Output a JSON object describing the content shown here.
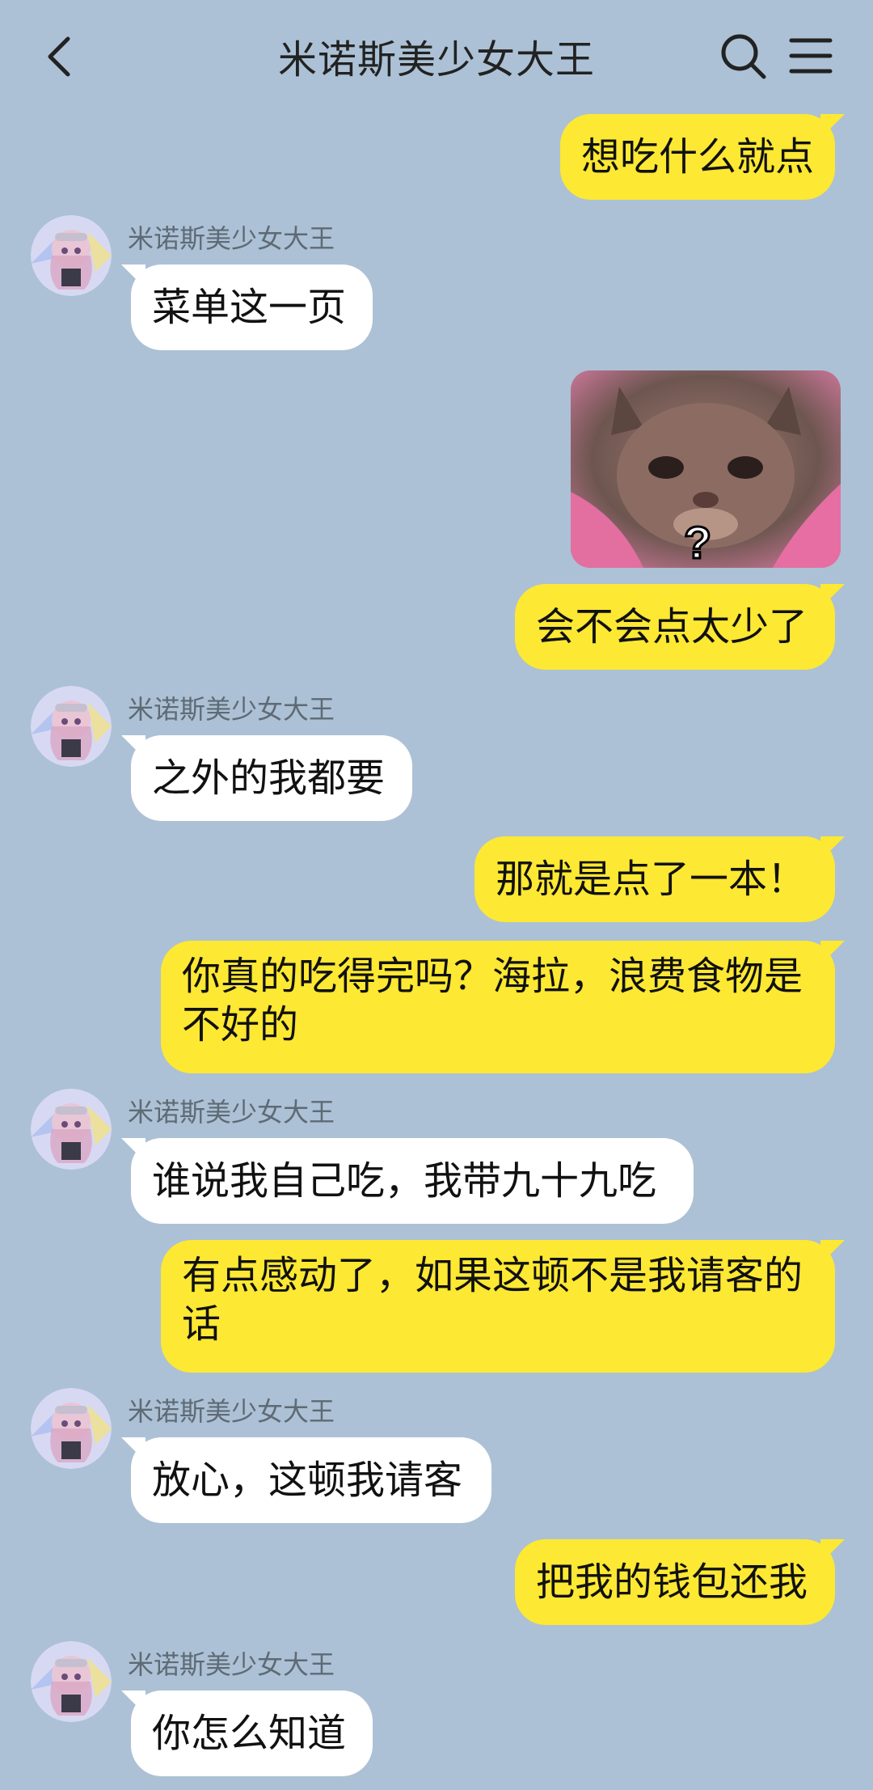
{
  "header": {
    "title": "米诺斯美少女大王",
    "back_icon": "chevron-left-icon",
    "search_icon": "search-icon",
    "menu_icon": "menu-icon"
  },
  "contact": {
    "name": "米诺斯美少女大王"
  },
  "messages": [
    {
      "from": "me",
      "text": "想吃什么就点"
    },
    {
      "from": "contact",
      "text": "菜单这一页"
    },
    {
      "from": "me",
      "type": "image",
      "alt": "cat-sticker"
    },
    {
      "from": "me",
      "text": "会不会点太少了"
    },
    {
      "from": "contact",
      "text": "之外的我都要"
    },
    {
      "from": "me",
      "text": "那就是点了一本！"
    },
    {
      "from": "me",
      "text": "你真的吃得完吗？海拉，浪费食物是不好的"
    },
    {
      "from": "contact",
      "text": "谁说我自己吃，我带九十九吃"
    },
    {
      "from": "me",
      "text": "有点感动了，如果这顿不是我请客的话"
    },
    {
      "from": "contact",
      "text": "放心，这顿我请客"
    },
    {
      "from": "me",
      "text": "把我的钱包还我"
    },
    {
      "from": "contact",
      "text": "你怎么知道"
    }
  ],
  "colors": {
    "background": "#acc1d5",
    "outgoing_bubble": "#fde833",
    "incoming_bubble": "#ffffff"
  }
}
